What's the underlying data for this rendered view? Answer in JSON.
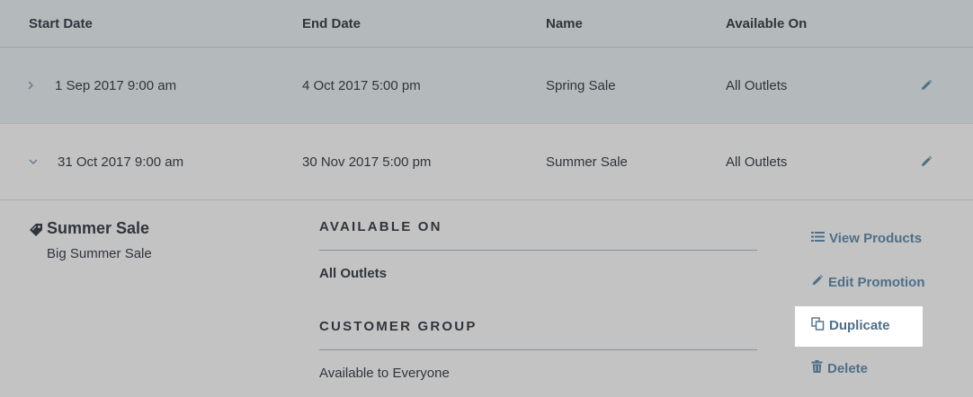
{
  "columns": {
    "start_date": "Start Date",
    "end_date": "End Date",
    "name": "Name",
    "available_on": "Available On"
  },
  "rows": [
    {
      "expanded": false,
      "chevron": "›",
      "start": "1 Sep 2017 9:00 am",
      "end": "4 Oct 2017 5:00 pm",
      "name": "Spring Sale",
      "available": "All Outlets",
      "action_icon": "pencil-icon"
    },
    {
      "expanded": true,
      "chevron": "⌄",
      "start": "31 Oct 2017 9:00 am",
      "end": "30 Nov 2017 5:00 pm",
      "name": "Summer Sale",
      "available": "All Outlets",
      "action_icon": "pencil-icon"
    }
  ],
  "detail": {
    "title": "Summer Sale",
    "subtitle": "Big Summer Sale",
    "available_on_heading": "AVAILABLE ON",
    "available_on_value": "All Outlets",
    "customer_group_heading": "CUSTOMER GROUP",
    "customer_group_value": "Available to Everyone",
    "actions": {
      "view_products": "View Products",
      "edit_promotion": "Edit Promotion",
      "duplicate": "Duplicate",
      "delete": "Delete"
    }
  },
  "colors": {
    "header_bg": "#b4b9bb",
    "body_bg": "#c3c3c3",
    "text": "#2f353b",
    "link": "#4e6f87",
    "highlight": "#ffffff"
  }
}
